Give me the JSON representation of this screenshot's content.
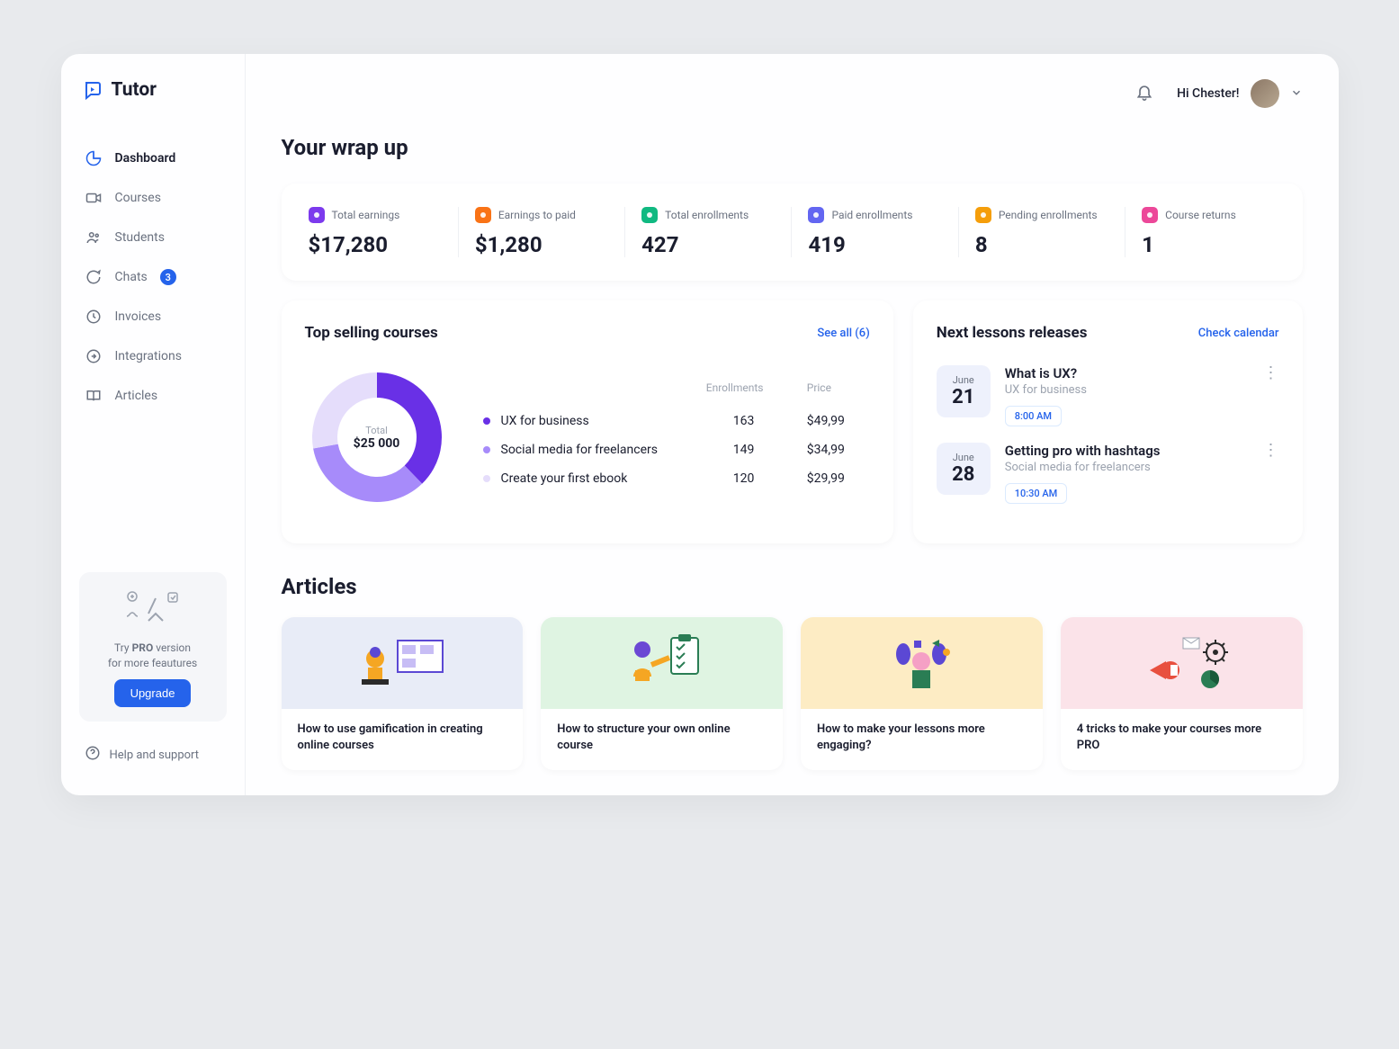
{
  "brand": "Tutor",
  "sidebar": {
    "items": [
      {
        "label": "Dashboard"
      },
      {
        "label": "Courses"
      },
      {
        "label": "Students"
      },
      {
        "label": "Chats",
        "badge": "3"
      },
      {
        "label": "Invoices"
      },
      {
        "label": "Integrations"
      },
      {
        "label": "Articles"
      }
    ],
    "promo": {
      "line1": "Try",
      "bold": "PRO",
      "line2": "version",
      "line3": "for more feautures",
      "cta": "Upgrade"
    },
    "help": "Help and support"
  },
  "topbar": {
    "greeting": "Hi Chester!"
  },
  "heading": "Your wrap up",
  "stats": [
    {
      "label": "Total earnings",
      "value": "$17,280",
      "color": "#7c3aed"
    },
    {
      "label": "Earnings to paid",
      "value": "$1,280",
      "color": "#f97316"
    },
    {
      "label": "Total enrollments",
      "value": "427",
      "color": "#10b981"
    },
    {
      "label": "Paid enrollments",
      "value": "419",
      "color": "#6366f1"
    },
    {
      "label": "Pending enrollments",
      "value": "8",
      "color": "#f59e0b"
    },
    {
      "label": "Course returns",
      "value": "1",
      "color": "#ec4899"
    }
  ],
  "top_selling": {
    "title": "Top selling courses",
    "see_all": "See all (6)",
    "total_label": "Total",
    "total_value": "$25 000",
    "col_enrollments": "Enrollments",
    "col_price": "Price",
    "rows": [
      {
        "name": "UX for business",
        "enrollments": "163",
        "price": "$49,99",
        "color": "#6930e6"
      },
      {
        "name": "Social media for freelancers",
        "enrollments": "149",
        "price": "$34,99",
        "color": "#a78bfa"
      },
      {
        "name": "Create your first ebook",
        "enrollments": "120",
        "price": "$29,99",
        "color": "#e5ddfb"
      }
    ]
  },
  "lessons": {
    "title": "Next lessons releases",
    "link": "Check calendar",
    "items": [
      {
        "month": "June",
        "day": "21",
        "title": "What is UX?",
        "course": "UX for business",
        "time": "8:00 AM"
      },
      {
        "month": "June",
        "day": "28",
        "title": "Getting pro with hashtags",
        "course": "Social media for freelancers",
        "time": "10:30 AM"
      }
    ]
  },
  "articles": {
    "title": "Articles",
    "items": [
      {
        "title": "How to use gamification in creating online courses",
        "bg": "#e8ecf7"
      },
      {
        "title": "How to structure your own online course",
        "bg": "#dff4e2"
      },
      {
        "title": "How to make your lessons more engaging?",
        "bg": "#fdecc4"
      },
      {
        "title": "4 tricks to make your courses more PRO",
        "bg": "#fbe3e9"
      }
    ]
  },
  "chart_data": {
    "type": "pie",
    "title": "Top selling courses",
    "total_label": "Total",
    "total": 25000,
    "series": [
      {
        "name": "UX for business",
        "value": 163,
        "color": "#6930e6"
      },
      {
        "name": "Social media for freelancers",
        "value": 149,
        "color": "#a78bfa"
      },
      {
        "name": "Create your first ebook",
        "value": 120,
        "color": "#e5ddfb"
      }
    ]
  }
}
